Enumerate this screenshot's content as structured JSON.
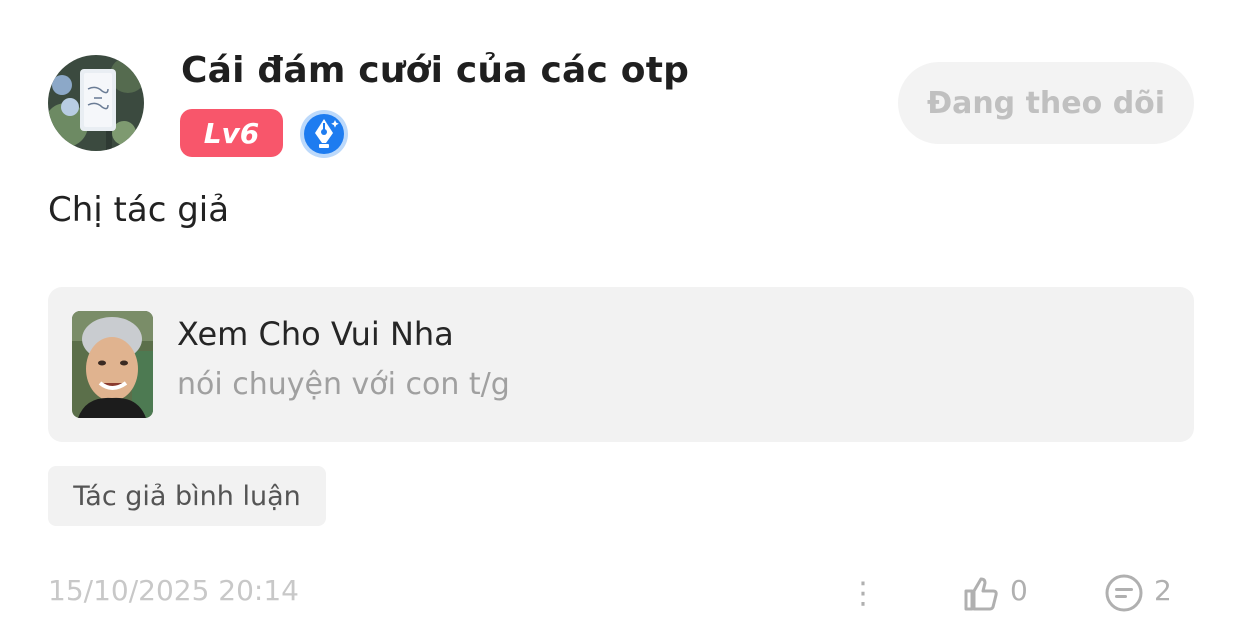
{
  "header": {
    "username": "Cái đám cưới của các otp",
    "level": "Lv6",
    "follow_button": "Đang theo dõi"
  },
  "comment": {
    "text": "Chị tác giả"
  },
  "quote": {
    "title": "Xem Cho Vui Nha",
    "subtitle": "nói chuyện với con t/g"
  },
  "tag": {
    "label": "Tác giả bình luận"
  },
  "footer": {
    "timestamp": "15/10/2025 20:14",
    "more": "⋮",
    "likes": "0",
    "comments": "2"
  },
  "colors": {
    "level_badge": "#f8566b",
    "verified_blue": "#1e7cf0",
    "card_bg": "#f2f2f2"
  },
  "icons": {
    "verified": "pen-nib-badge-icon",
    "like": "thumbs-up-icon",
    "comment": "comment-bubble-icon",
    "more": "more-icon"
  }
}
